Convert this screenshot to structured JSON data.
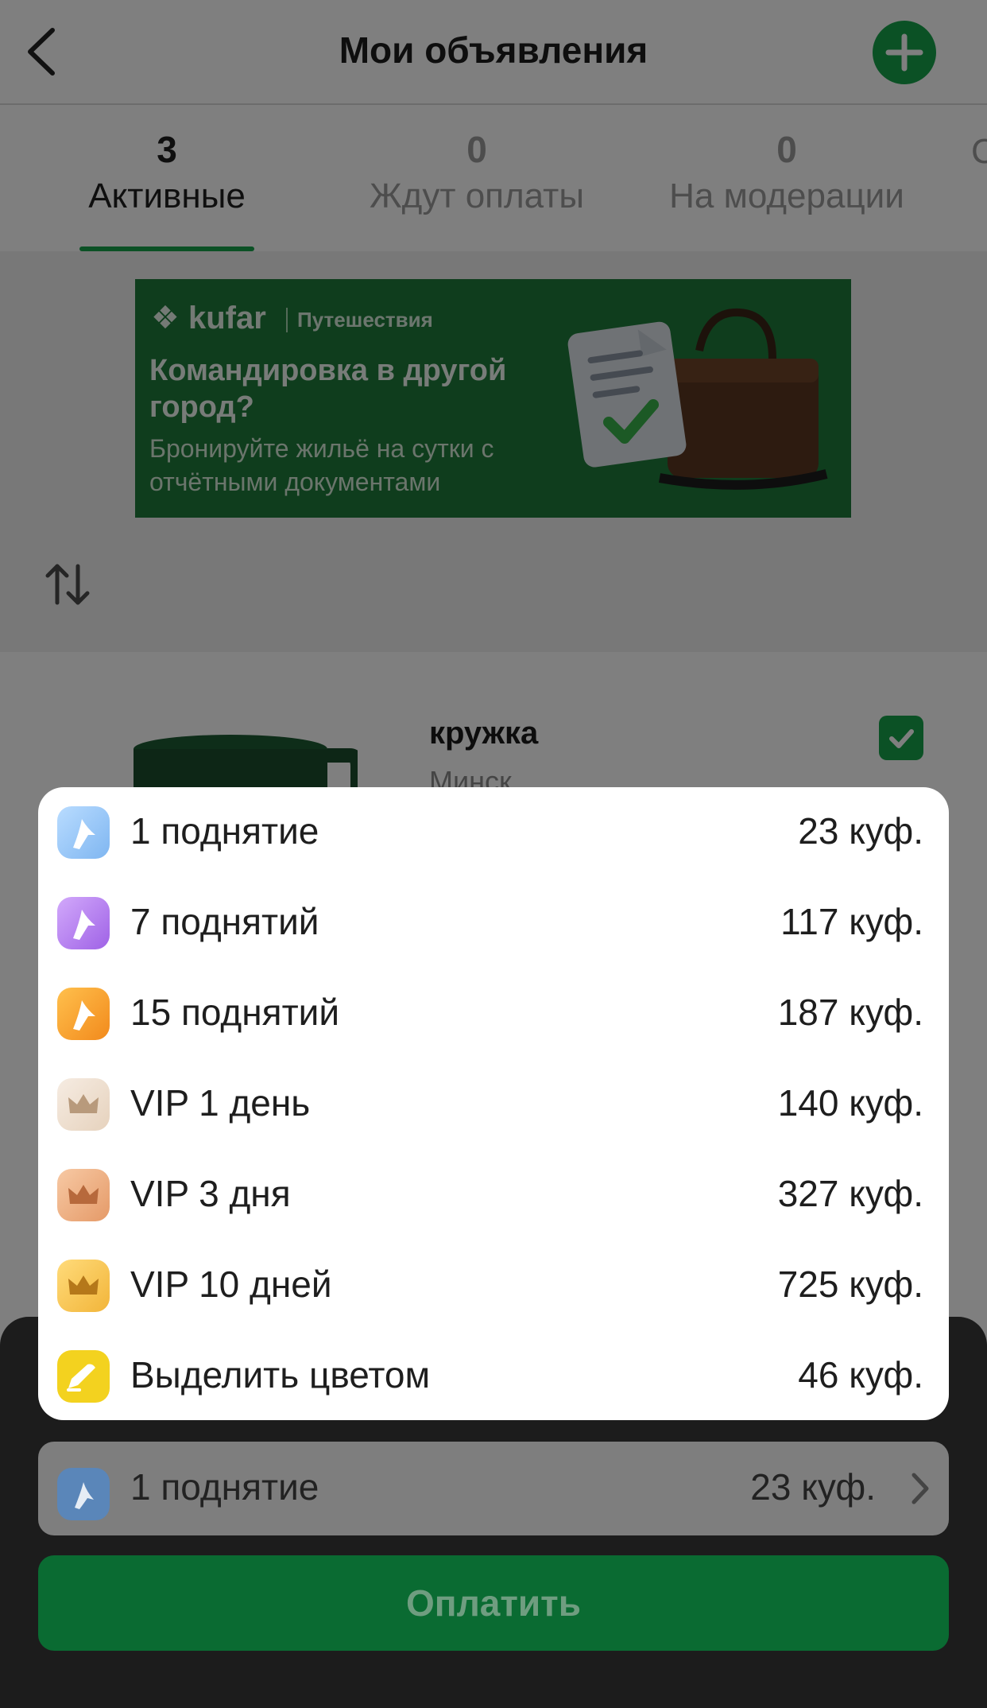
{
  "header": {
    "title": "Мои объявления"
  },
  "tabs": [
    {
      "count": "3",
      "label": "Активные"
    },
    {
      "count": "0",
      "label": "Ждут оплаты"
    },
    {
      "count": "0",
      "label": "На модерации"
    },
    {
      "count": "",
      "label": "С"
    }
  ],
  "banner": {
    "brand": "kufar",
    "section": "Путешествия",
    "headline": "Командировка в другой город?",
    "text": "Бронируйте жильё на сутки с отчётными документами"
  },
  "listing": {
    "title": "кружка",
    "city": "Минск"
  },
  "options": [
    {
      "name": "1 поднятие",
      "price": "23 куф.",
      "icon": "lift-icon",
      "color": "#8ec5f5"
    },
    {
      "name": "7 поднятий",
      "price": "117 куф.",
      "icon": "lift-icon",
      "color": "#b884ee"
    },
    {
      "name": "15 поднятий",
      "price": "187 куф.",
      "icon": "lift-icon",
      "color": "#f7a233"
    },
    {
      "name": "VIP 1 день",
      "price": "140 куф.",
      "icon": "crown-icon",
      "color": "#ecdccb"
    },
    {
      "name": "VIP 3 дня",
      "price": "327 куф.",
      "icon": "crown-icon",
      "color": "#eeb487"
    },
    {
      "name": "VIP 10 дней",
      "price": "725 куф.",
      "icon": "crown-icon",
      "color": "#f8c85a"
    },
    {
      "name": "Выделить цветом",
      "price": "46 куф.",
      "icon": "highlight-icon",
      "color": "#f3d21f"
    }
  ],
  "selected": {
    "name": "1 поднятие",
    "price": "23 куф."
  },
  "pay_button": "Оплатить",
  "colors": {
    "brand_green": "#17a34a",
    "overlay": "rgba(0,0,0,0.5)"
  }
}
